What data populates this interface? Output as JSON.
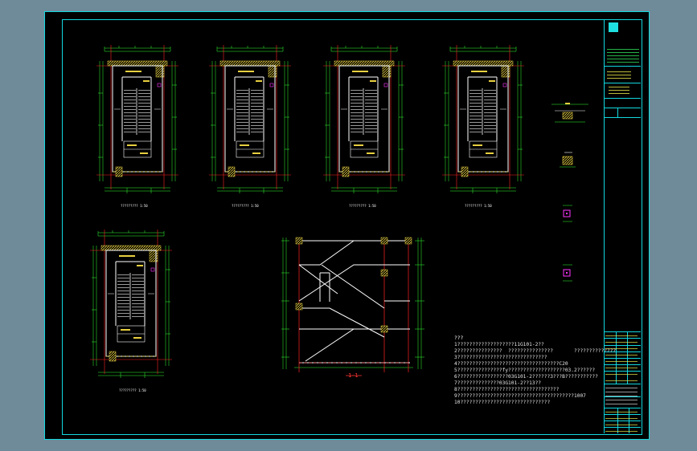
{
  "notes": {
    "lines": [
      "???",
      "1???????????????????11G101-2??",
      "2???????????????  ???????????????       ??????????????",
      "3??????????????????????????????",
      "4??????????????????????????????????C20",
      "5???????????????fy???????????????????03.2??????",
      "6?????????????????03G101-2??????3???B???????????",
      "7??????????????03G101-2??13??",
      "8??????????????????????????????????",
      "9???????????????????????????????????????1007",
      "10??????????????????????????????"
    ]
  },
  "section_label": "1-1",
  "plan_captions": [
    "????????? 1:50",
    "????????? 1:50",
    "????????? 1:50",
    "????????? 1:50",
    "????????? 1:50"
  ],
  "colors": {
    "background": "#6f8b9a",
    "sheet": "#000000",
    "frame": "#11d8e0",
    "wall": "#ffffff",
    "grid": "#ff2222",
    "dimension": "#33ff33",
    "hatch": "#e8d040",
    "accent": "#ff33ff"
  }
}
